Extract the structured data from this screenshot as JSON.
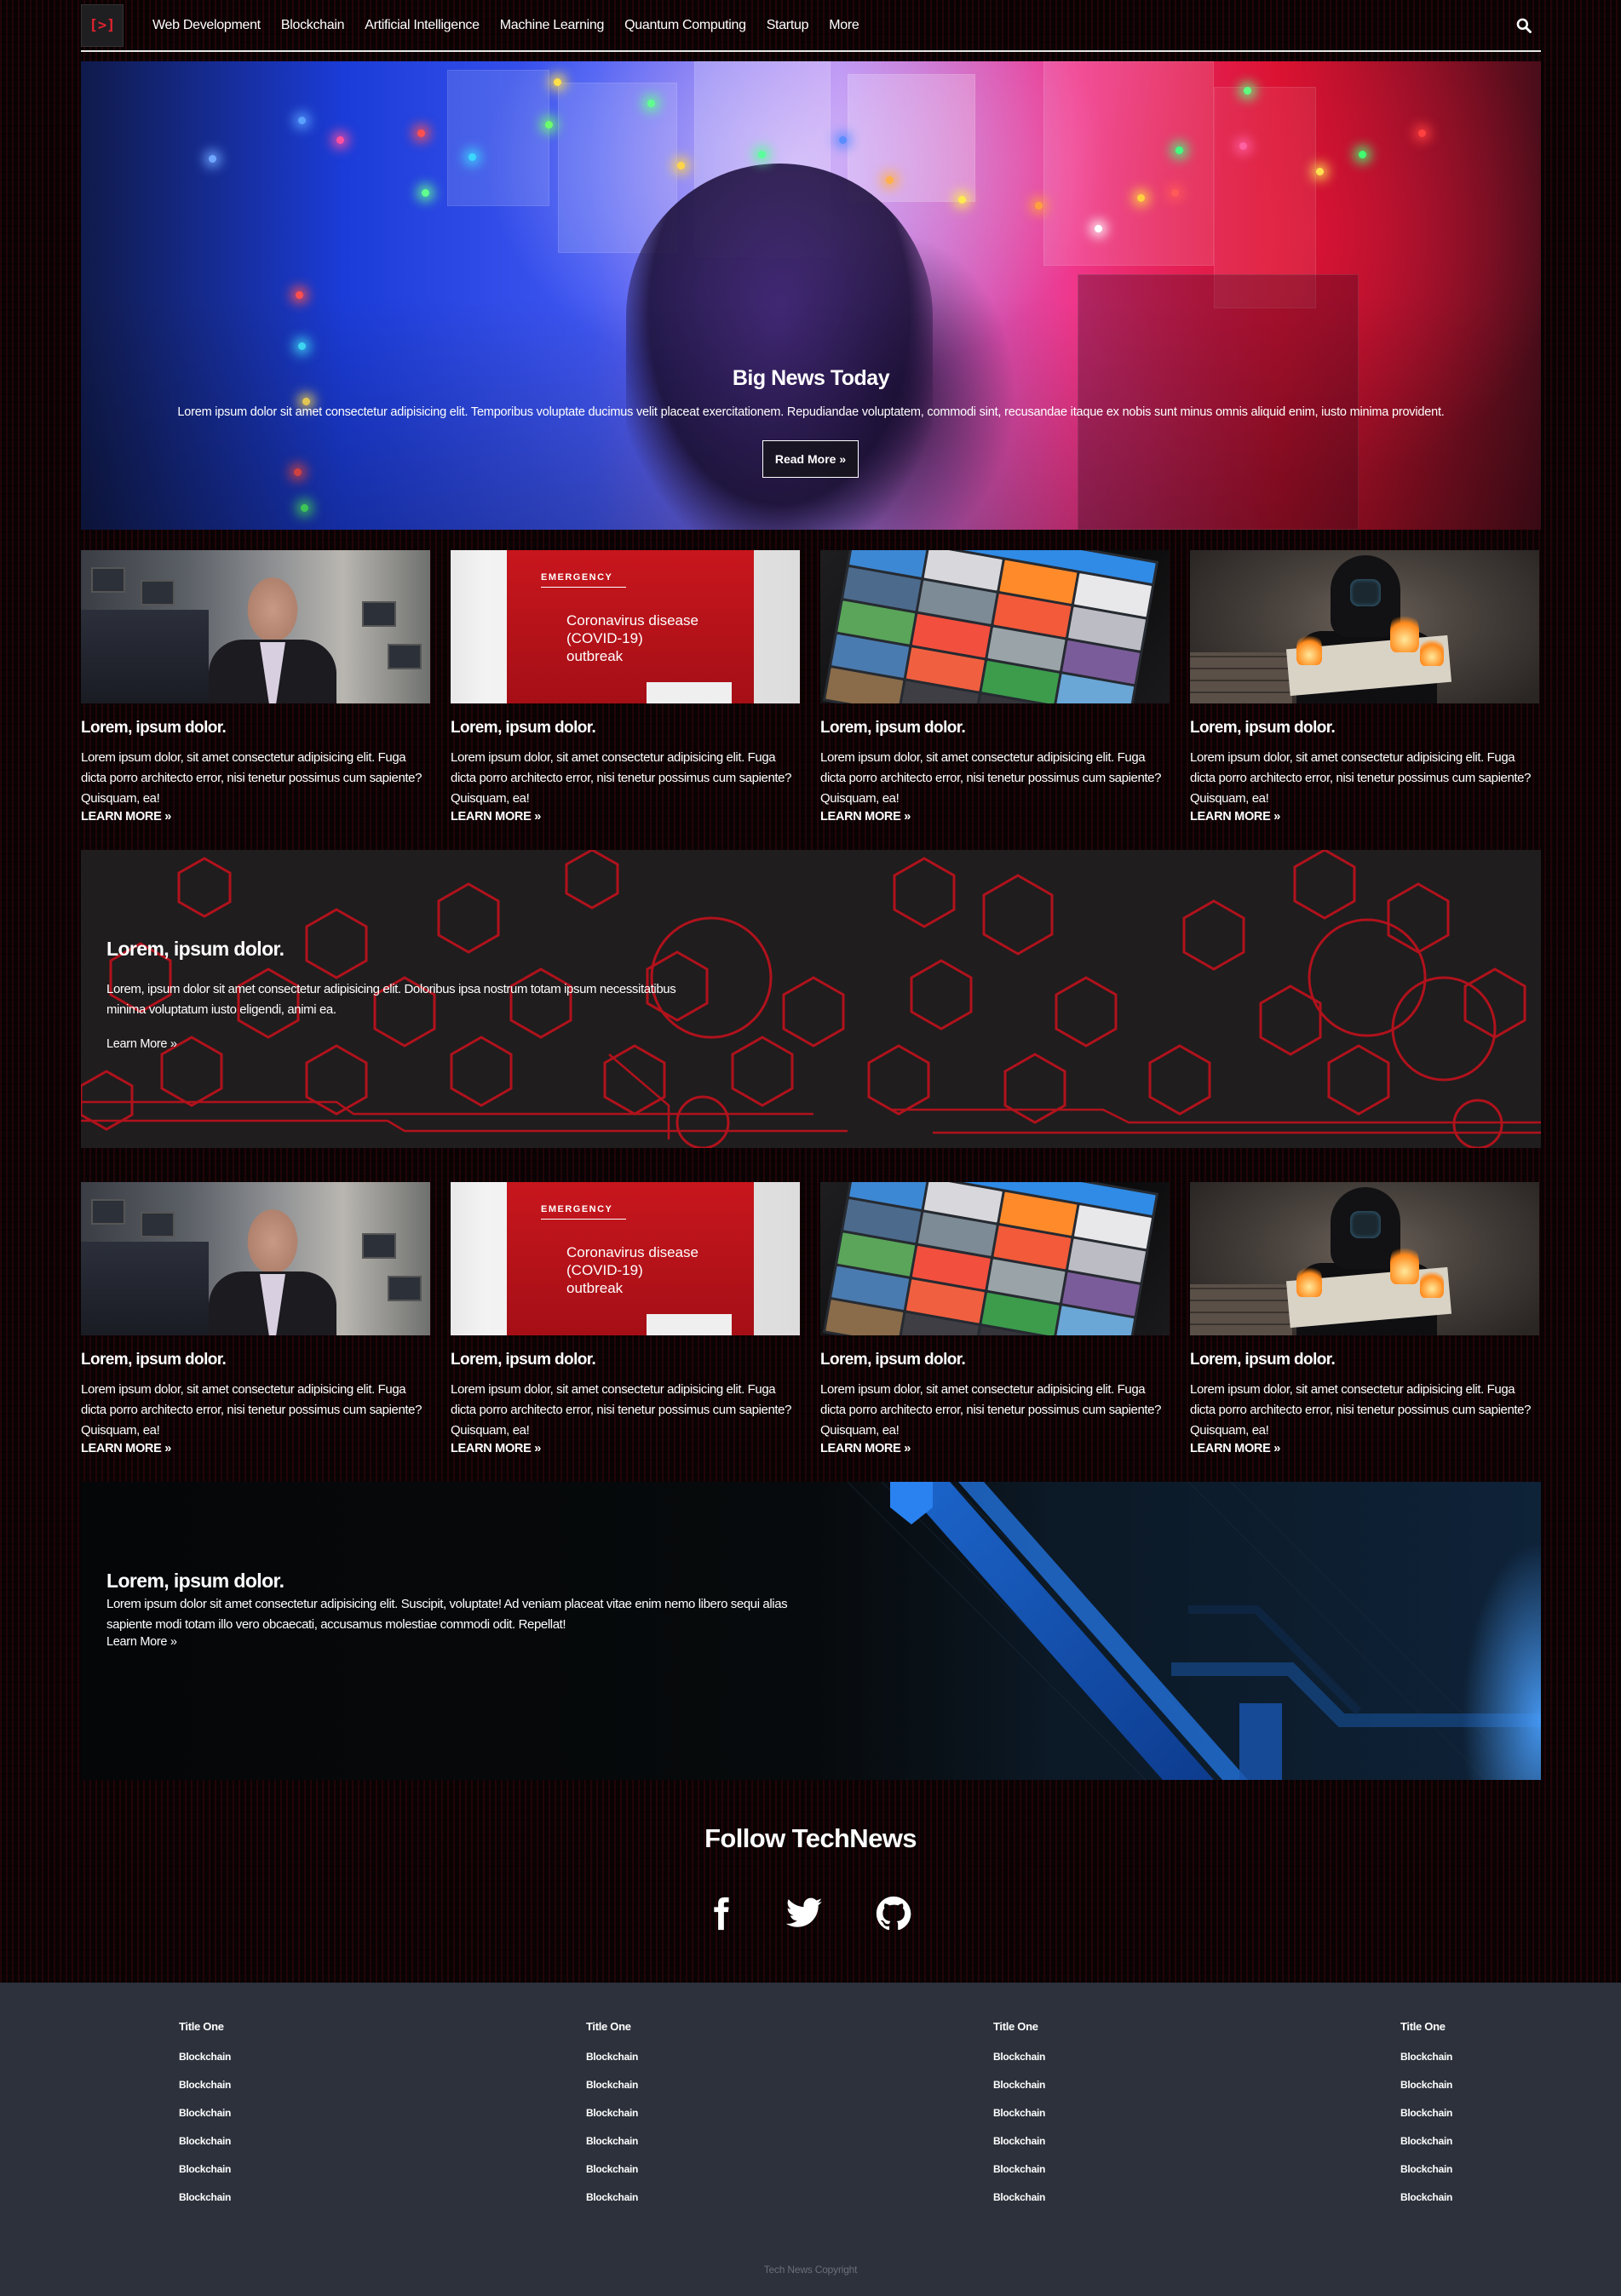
{
  "brand": {
    "logo_text": "[>]",
    "accent": "#e4232f"
  },
  "nav": {
    "items": [
      "Web Development",
      "Blockchain",
      "Artificial Intelligence",
      "Machine Learning",
      "Quantum Computing",
      "Startup",
      "More"
    ],
    "search_icon": "search-icon"
  },
  "hero": {
    "title": "Big News Today",
    "text": "Lorem ipsum dolor sit amet consectetur adipisicing elit. Temporibus voluptate ducimus velit placeat exercitationem. Repudiandae voluptatem, commodi sint, recusandae itaque ex nobis sunt minus omnis aliquid enim, iusto minima provident.",
    "button": "Read More »"
  },
  "cards_row1": [
    {
      "title": "Lorem, ipsum dolor.",
      "text": "Lorem ipsum dolor, sit amet consectetur adipisicing elit. Fuga dicta porro architecto error, nisi tenetur possimus cum sapiente? Quisquam, ea!",
      "link": "LEARN MORE »",
      "image": "speaker-photo"
    },
    {
      "title": "Lorem, ipsum dolor.",
      "text": "Lorem ipsum dolor, sit amet consectetur adipisicing elit. Fuga dicta porro architecto error, nisi tenetur possimus cum sapiente? Quisquam, ea!",
      "link": "LEARN MORE »",
      "image": "covid-sign-photo",
      "image_text": {
        "label": "EMERGENCY",
        "caption": "Coronavirus disease (COVID-19) outbreak"
      }
    },
    {
      "title": "Lorem, ipsum dolor.",
      "text": "Lorem ipsum dolor, sit amet consectetur adipisicing elit. Fuga dicta porro architecto error, nisi tenetur possimus cum sapiente? Quisquam, ea!",
      "link": "LEARN MORE »",
      "image": "tablet-photo"
    },
    {
      "title": "Lorem, ipsum dolor.",
      "text": "Lorem ipsum dolor, sit amet consectetur adipisicing elit. Fuga dicta porro architecto error, nisi tenetur possimus cum sapiente? Quisquam, ea!",
      "link": "LEARN MORE »",
      "image": "hacker-photo"
    }
  ],
  "banner1": {
    "title": "Lorem, ipsum dolor.",
    "text": "Lorem, ipsum dolor sit amet consectetur adipisicing elit. Doloribus ipsa nostrum totam ipsum necessitatibus minima voluptatum iusto eligendi, animi ea.",
    "link": "Learn More »"
  },
  "cards_row2": [
    {
      "title": "Lorem, ipsum dolor.",
      "text": "Lorem ipsum dolor, sit amet consectetur adipisicing elit. Fuga dicta porro architecto error, nisi tenetur possimus cum sapiente? Quisquam, ea!",
      "link": "LEARN MORE »",
      "image": "speaker-photo"
    },
    {
      "title": "Lorem, ipsum dolor.",
      "text": "Lorem ipsum dolor, sit amet consectetur adipisicing elit. Fuga dicta porro architecto error, nisi tenetur possimus cum sapiente? Quisquam, ea!",
      "link": "LEARN MORE »",
      "image": "covid-sign-photo",
      "image_text": {
        "label": "EMERGENCY",
        "caption": "Coronavirus disease (COVID-19) outbreak"
      }
    },
    {
      "title": "Lorem, ipsum dolor.",
      "text": "Lorem ipsum dolor, sit amet consectetur adipisicing elit. Fuga dicta porro architecto error, nisi tenetur possimus cum sapiente? Quisquam, ea!",
      "link": "LEARN MORE »",
      "image": "tablet-photo"
    },
    {
      "title": "Lorem, ipsum dolor.",
      "text": "Lorem ipsum dolor, sit amet consectetur adipisicing elit. Fuga dicta porro architecto error, nisi tenetur possimus cum sapiente? Quisquam, ea!",
      "link": "LEARN MORE »",
      "image": "hacker-photo"
    }
  ],
  "banner2": {
    "title": "Lorem, ipsum dolor.",
    "text": "Lorem ipsum dolor sit amet consectetur adipisicing elit. Suscipit, voluptate! Ad veniam placeat vitae enim nemo libero sequi alias sapiente modi totam illo vero obcaecati, accusamus molestiae commodi odit. Repellat!",
    "link": "Learn More »"
  },
  "follow": {
    "title": "Follow TechNews",
    "icons": [
      "facebook-icon",
      "twitter-icon",
      "github-icon"
    ]
  },
  "footer": {
    "columns": [
      {
        "title": "Title One",
        "items": [
          "Blockchain",
          "Blockchain",
          "Blockchain",
          "Blockchain",
          "Blockchain",
          "Blockchain"
        ]
      },
      {
        "title": "Title One",
        "items": [
          "Blockchain",
          "Blockchain",
          "Blockchain",
          "Blockchain",
          "Blockchain",
          "Blockchain"
        ]
      },
      {
        "title": "Title One",
        "items": [
          "Blockchain",
          "Blockchain",
          "Blockchain",
          "Blockchain",
          "Blockchain",
          "Blockchain"
        ]
      },
      {
        "title": "Title One",
        "items": [
          "Blockchain",
          "Blockchain",
          "Blockchain",
          "Blockchain",
          "Blockchain",
          "Blockchain"
        ]
      }
    ],
    "copyright": "Tech News Copyright"
  },
  "colors": {
    "footer_bg": "#2c313b",
    "hex_red": "#b0121c",
    "accent_blue": "#1e6fe0"
  }
}
